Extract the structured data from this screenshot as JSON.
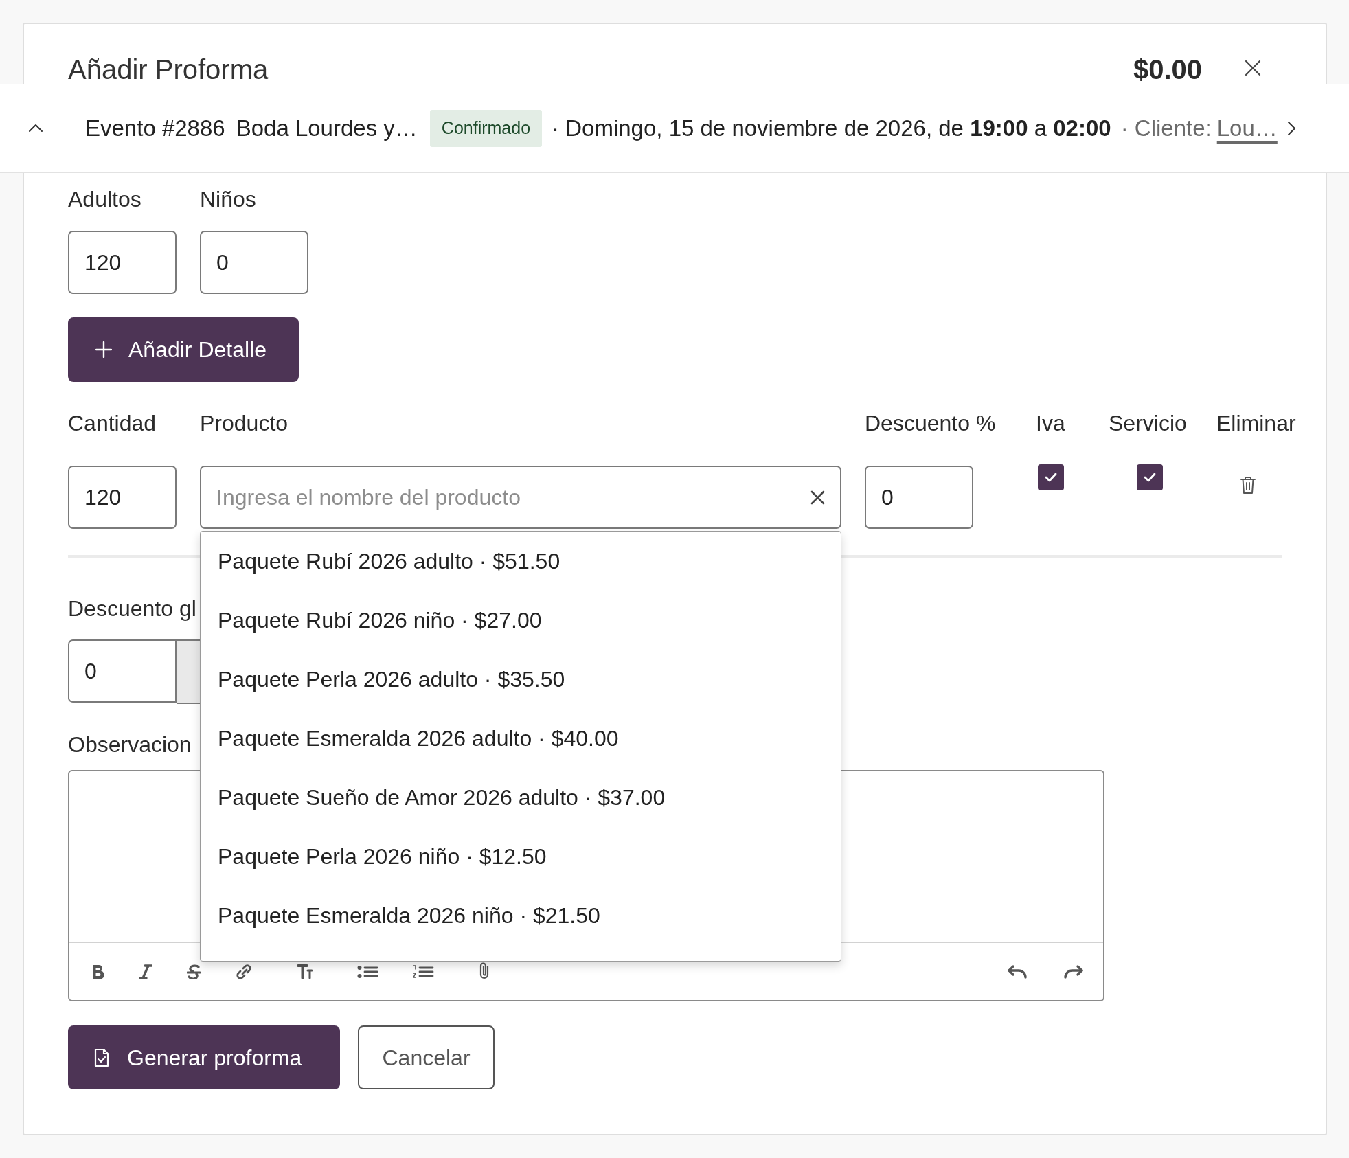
{
  "header": {
    "title": "Añadir Proforma",
    "total": "$0.00"
  },
  "event_bar": {
    "event_number": "Evento #2886",
    "event_name": "Boda Lourdes y…",
    "status": "Confirmado",
    "date_text": "· Domingo, 15 de noviembre de 2026, de **19:00** a **02:00**",
    "client_label": "· Cliente:",
    "client_name": "Lou…"
  },
  "guests": [
    {
      "label": "Adultos",
      "value": "120"
    },
    {
      "label": "Niños",
      "value": "0"
    }
  ],
  "add_detail_button": {
    "label": "Añadir Detalle"
  },
  "detail_columns": [
    "Cantidad",
    "Producto",
    "Descuento %",
    "Iva",
    "Servicio",
    "Eliminar"
  ],
  "detail_rows": [
    {
      "quantity": "120",
      "product_placeholder": "Ingresa el nombre del producto",
      "discount": "0",
      "iva": true,
      "service": true
    }
  ],
  "product_suggestions": [
    "Paquete Rubí 2026 adulto · $51.50",
    "Paquete Rubí 2026 niño · $27.00",
    "Paquete Perla 2026 adulto · $35.50",
    "Paquete Esmeralda 2026 adulto · $40.00",
    "Paquete Sueño de Amor 2026 adulto · $37.00",
    "Paquete Perla 2026 niño · $12.50",
    "Paquete Esmeralda 2026 niño · $21.50"
  ],
  "global_discount": {
    "label": "Descuento gl",
    "value": "0"
  },
  "observations": {
    "label": "Observacion"
  },
  "buttons": [
    {
      "label": "Generar proforma",
      "kind": "primary"
    },
    {
      "label": "Cancelar",
      "kind": "secondary"
    }
  ]
}
